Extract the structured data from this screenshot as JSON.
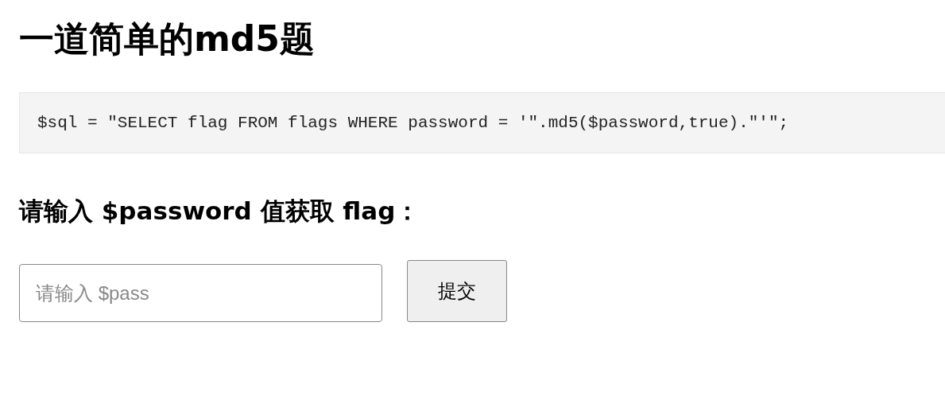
{
  "title": "一道简单的md5题",
  "code": "$sql = \"SELECT flag FROM flags WHERE password = '\".md5($password,true).\"'\";",
  "prompt": "请输入 $password 值获取 flag：",
  "form": {
    "placeholder": "请输入 $pass",
    "button": "提交"
  }
}
